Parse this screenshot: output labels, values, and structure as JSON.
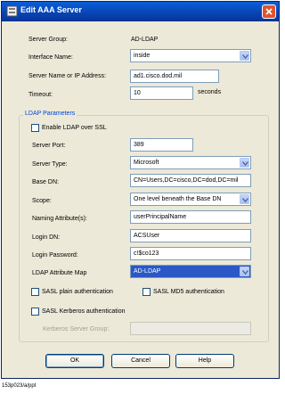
{
  "window": {
    "title": "Edit AAA Server"
  },
  "form": {
    "server_group_label": "Server Group:",
    "server_group_value": "AD-LDAP",
    "interface_label": "Interface Name:",
    "interface_value": "inside",
    "server_name_label": "Server Name or IP Address:",
    "server_name_value": "ad1.cisco.dod.mil",
    "timeout_label": "Timeout:",
    "timeout_value": "10",
    "timeout_unit": "seconds"
  },
  "ldap": {
    "group_title": "LDAP Parameters",
    "enable_ssl_label": "Enable LDAP over SSL",
    "server_port_label": "Server Port:",
    "server_port_value": "389",
    "server_type_label": "Server Type:",
    "server_type_value": "Microsoft",
    "base_dn_label": "Base DN:",
    "base_dn_value": "CN=Users,DC=cisco,DC=dod,DC=mil",
    "scope_label": "Scope:",
    "scope_value": "One level beneath the Base DN",
    "naming_attr_label": "Naming Attribute(s):",
    "naming_attr_value": "userPrincipalName",
    "login_dn_label": "Login DN:",
    "login_dn_value": "ACSUser",
    "login_password_label": "Login Password:",
    "login_password_value": "c!$co123",
    "attr_map_label": "LDAP Attribute Map",
    "attr_map_value": "AD-LDAP",
    "sasl_plain_label": "SASL plain authentication",
    "sasl_md5_label": "SASL MD5 authentication",
    "sasl_kerberos_label": "SASL Kerberos authentication",
    "kerberos_group_label": "Kerberos Server Group:",
    "kerberos_group_value": ""
  },
  "buttons": {
    "ok": "OK",
    "cancel": "Cancel",
    "help": "Help"
  },
  "caption": "153p023/a/ppt",
  "colors": {
    "titlebar": "#0a5fd8",
    "group_title": "#0046d5",
    "selection": "#2a58c6"
  }
}
